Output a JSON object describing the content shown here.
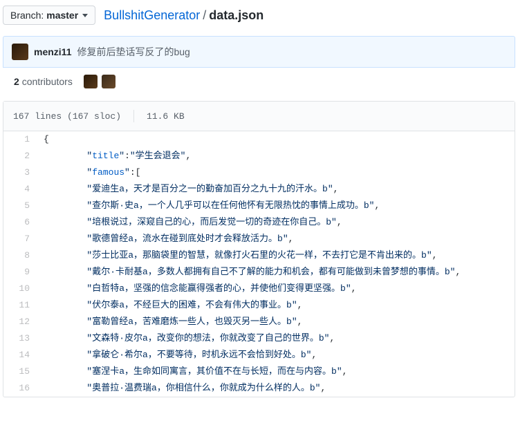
{
  "branch": {
    "label": "Branch:",
    "name": "master"
  },
  "breadcrumb": {
    "repo": "BullshitGenerator",
    "file": "data.json"
  },
  "commit": {
    "author": "menzi11",
    "message": "修复前后垫话写反了的bug"
  },
  "contributors": {
    "count": "2",
    "label": "contributors"
  },
  "file_meta": {
    "lines": "167 lines (167 sloc)",
    "size": "11.6 KB"
  },
  "code_lines": [
    {
      "num": "1",
      "indent": 0,
      "plain": "{"
    },
    {
      "num": "2",
      "indent": 2,
      "key": "title",
      "val": "学生会退会",
      "comma": true
    },
    {
      "num": "3",
      "indent": 2,
      "key": "famous",
      "open_array": true
    },
    {
      "num": "4",
      "indent": 2,
      "val": "爱迪生a，天才是百分之一的勤奋加百分之九十九的汗水。b",
      "comma": true
    },
    {
      "num": "5",
      "indent": 2,
      "val": "查尔斯·史a，一个人几乎可以在任何他怀有无限热忱的事情上成功。b",
      "comma": true
    },
    {
      "num": "6",
      "indent": 2,
      "val": "培根说过，深窥自己的心，而后发觉一切的奇迹在你自己。b",
      "comma": true
    },
    {
      "num": "7",
      "indent": 2,
      "val": "歌德曾经a，流水在碰到底处时才会释放活力。b",
      "comma": true
    },
    {
      "num": "8",
      "indent": 2,
      "val": "莎士比亚a，那脑袋里的智慧，就像打火石里的火花一样，不去打它是不肯出来的。b",
      "comma": true
    },
    {
      "num": "9",
      "indent": 2,
      "val": "戴尔·卡耐基a，多数人都拥有自己不了解的能力和机会，都有可能做到未曾梦想的事情。b",
      "comma": true
    },
    {
      "num": "10",
      "indent": 2,
      "val": "白哲特a，坚强的信念能赢得强者的心，并使他们变得更坚强。b",
      "comma": true
    },
    {
      "num": "11",
      "indent": 2,
      "val": "伏尔泰a，不经巨大的困难，不会有伟大的事业。b",
      "comma": true
    },
    {
      "num": "12",
      "indent": 2,
      "val": "富勒曾经a，苦难磨炼一些人，也毁灭另一些人。b",
      "comma": true
    },
    {
      "num": "13",
      "indent": 2,
      "val": "文森特·皮尔a，改变你的想法，你就改变了自己的世界。b",
      "comma": true
    },
    {
      "num": "14",
      "indent": 2,
      "val": "拿破仑·希尔a，不要等待，时机永远不会恰到好处。b",
      "comma": true
    },
    {
      "num": "15",
      "indent": 2,
      "val": "塞涅卡a，生命如同寓言，其价值不在与长短，而在与内容。b",
      "comma": true
    },
    {
      "num": "16",
      "indent": 2,
      "val": "奥普拉·温费瑞a，你相信什么，你就成为什么样的人。b",
      "comma": true,
      "cut": true
    }
  ]
}
